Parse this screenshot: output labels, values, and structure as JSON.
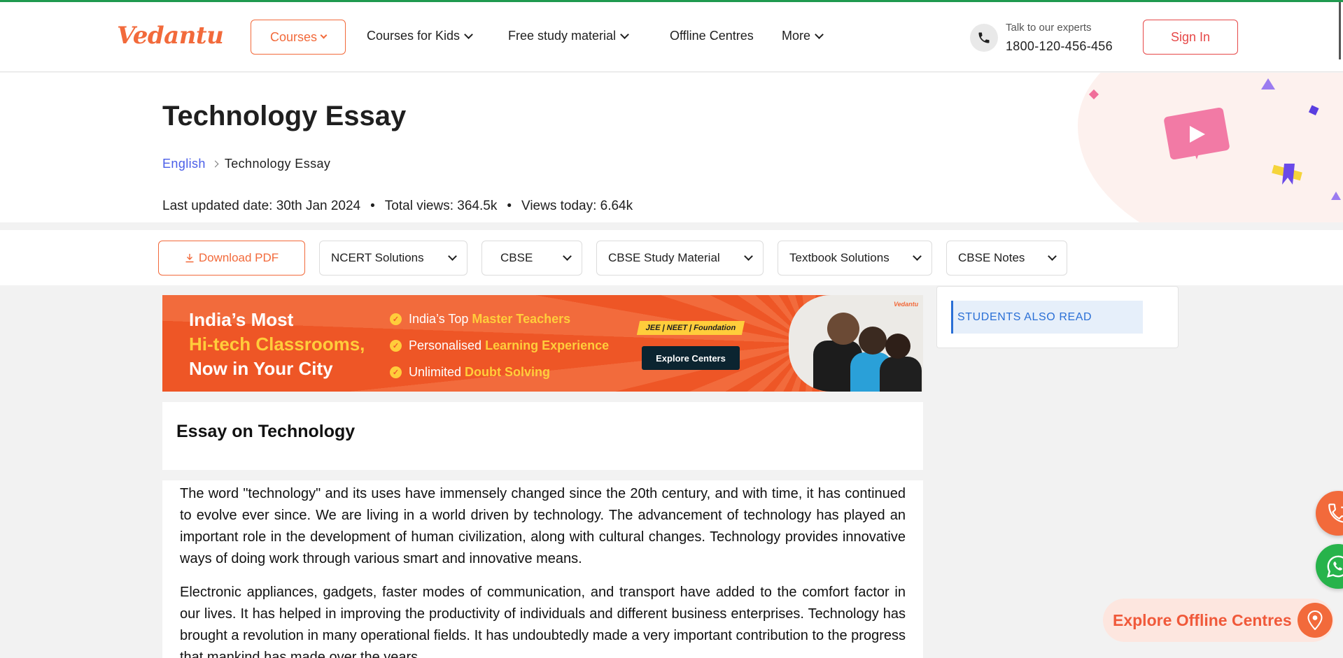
{
  "header": {
    "logo_text": "Vedantu",
    "courses_label": "Courses",
    "nav": [
      {
        "label": "Courses for Kids"
      },
      {
        "label": "Free study material"
      },
      {
        "label": "Offline Centres"
      },
      {
        "label": "More"
      }
    ],
    "talk_label": "Talk to our experts",
    "phone_number": "1800-120-456-456",
    "signin_label": "Sign In"
  },
  "hero": {
    "title": "Technology Essay",
    "breadcrumb": [
      "English",
      "Technology Essay"
    ],
    "last_updated": "Last updated date: 30th Jan 2024",
    "total_views": "Total views: 364.5k",
    "views_today": "Views today: 6.64k",
    "separator": "•"
  },
  "filters": {
    "download_label": "Download PDF",
    "dropdowns": [
      "NCERT Solutions",
      "CBSE",
      "CBSE Study Material",
      "Textbook Solutions",
      "CBSE Notes"
    ]
  },
  "banner": {
    "line1": "India’s Most",
    "line2": "Hi-tech Classrooms,",
    "line3": "Now in Your City",
    "points": [
      {
        "pre": "India’s Top ",
        "hl": "Master Teachers"
      },
      {
        "pre": "Personalised ",
        "hl": "Learning Experience"
      },
      {
        "pre": "Unlimited ",
        "hl": "Doubt Solving"
      }
    ],
    "tag": "JEE | NEET | Foundation",
    "cta": "Explore Centers",
    "mini_logo": "Vedantu"
  },
  "sidebar": {
    "heading": "STUDENTS ALSO READ"
  },
  "essay": {
    "title": "Essay on Technology",
    "paragraphs": [
      "The word \"technology\" and its uses have immensely changed since the 20th century, and with time, it has continued to evolve ever since. We are living in a world driven by technology. The advancement of technology has played an important role in the development of human civilization, along with cultural changes. Technology provides innovative ways of doing work through various smart and innovative means.",
      "Electronic appliances, gadgets, faster modes of communication, and transport have added to the comfort factor in our lives. It has helped in improving the productivity of individuals and different business enterprises. Technology has brought a revolution in many operational fields. It has undoubtedly made a very important contribution to the progress that mankind has made over the years."
    ]
  },
  "floating": {
    "explore_label": "Explore Offline Centres"
  },
  "colors": {
    "brand": "#f26a3b",
    "signin": "#e64848",
    "link": "#4a5ee8",
    "whatsapp": "#27b34b"
  }
}
